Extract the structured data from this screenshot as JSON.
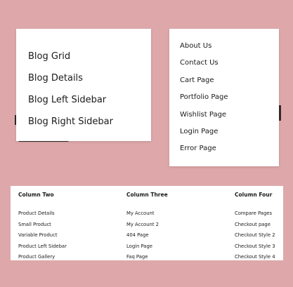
{
  "blog_menu": {
    "items": [
      {
        "label": "Blog Grid"
      },
      {
        "label": "Blog Details"
      },
      {
        "label": "Blog Left Sidebar"
      },
      {
        "label": "Blog Right Sidebar"
      }
    ]
  },
  "pages_menu": {
    "items": [
      {
        "label": "About Us"
      },
      {
        "label": "Contact Us"
      },
      {
        "label": "Cart Page"
      },
      {
        "label": "Portfolio Page"
      },
      {
        "label": "Wishlist Page"
      },
      {
        "label": "Login Page"
      },
      {
        "label": "Error Page"
      }
    ]
  },
  "mega_menu": {
    "columns": [
      {
        "title": "Column Two",
        "items": [
          "Product Details",
          "Small Product",
          "Variable Product",
          "Product Left Sidebar",
          "Product Gallery"
        ]
      },
      {
        "title": "Column Three",
        "items": [
          "My Account",
          "My Account 2",
          "404 Page",
          "Login Page",
          "Faq Page"
        ]
      },
      {
        "title": "Column Four",
        "items": [
          "Compare Pages",
          "Checkout page",
          "Checkout Style 2",
          "Checkout Style 3",
          "Checkout Style 4"
        ]
      }
    ]
  },
  "colors": {
    "background": "#dea8aa",
    "panel": "#ffffff",
    "text": "#1a1a1a"
  }
}
